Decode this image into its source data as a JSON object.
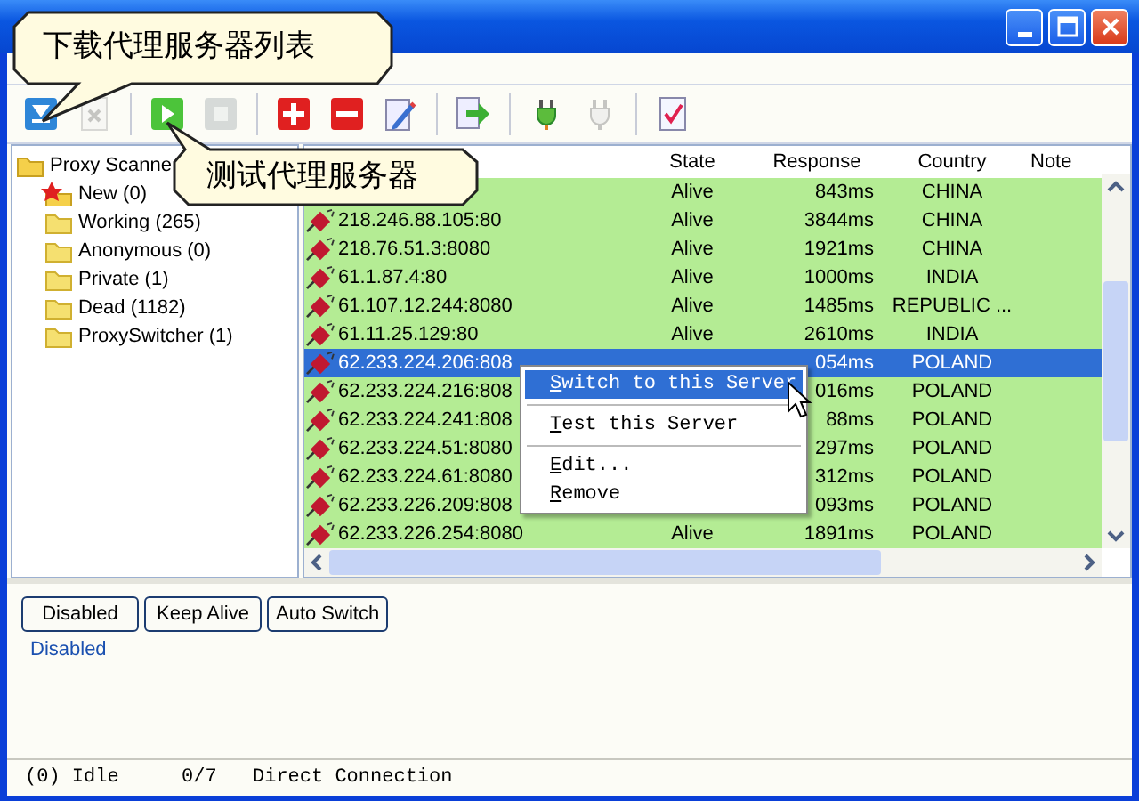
{
  "callouts": [
    {
      "text": "下载代理服务器列表",
      "kind": "down"
    },
    {
      "text": "测试代理服务器",
      "kind": "up"
    }
  ],
  "toolbar": [
    {
      "kind": "download",
      "disabled": false
    },
    {
      "kind": "delete",
      "disabled": true
    },
    {
      "kind": "play",
      "disabled": false
    },
    {
      "kind": "stop",
      "disabled": true
    },
    {
      "kind": "add",
      "disabled": false
    },
    {
      "kind": "remove",
      "disabled": false
    },
    {
      "kind": "edit",
      "disabled": false
    },
    {
      "kind": "export",
      "disabled": false
    },
    {
      "kind": "plug",
      "disabled": false
    },
    {
      "kind": "plug",
      "disabled": true
    },
    {
      "kind": "check",
      "disabled": false
    }
  ],
  "tree": {
    "label": "Proxy Scanne",
    "children": [
      {
        "label": "New (0)",
        "kind": "new"
      },
      {
        "label": "Working (265)",
        "kind": "folder"
      },
      {
        "label": "Anonymous (0)",
        "kind": "folder"
      },
      {
        "label": "Private (1)",
        "kind": "folder"
      },
      {
        "label": "Dead (1182)",
        "kind": "folder"
      },
      {
        "label": "ProxySwitcher (1)",
        "kind": "folder"
      }
    ]
  },
  "table": {
    "columns": [
      "State",
      "Response",
      "Country",
      "Note"
    ],
    "rows": [
      {
        "state": "Alive",
        "response": "843ms",
        "country": "CHINA",
        "selected": false
      },
      {
        "address": "218.246.88.105:80",
        "state": "Alive",
        "response": "3844ms",
        "country": "CHINA",
        "selected": false
      },
      {
        "address": "218.76.51.3:8080",
        "state": "Alive",
        "response": "1921ms",
        "country": "CHINA",
        "selected": false
      },
      {
        "address": "61.1.87.4:80",
        "state": "Alive",
        "response": "1000ms",
        "country": "INDIA",
        "selected": false
      },
      {
        "address": "61.107.12.244:8080",
        "state": "Alive",
        "response": "1485ms",
        "country": "REPUBLIC ...",
        "selected": false
      },
      {
        "address": "61.11.25.129:80",
        "state": "Alive",
        "response": "2610ms",
        "country": "INDIA",
        "selected": false
      },
      {
        "address": "62.233.224.206:808",
        "response": "054ms",
        "country": "POLAND",
        "selected": true
      },
      {
        "address": "62.233.224.216:808",
        "response": "016ms",
        "country": "POLAND",
        "selected": false
      },
      {
        "address": "62.233.224.241:808",
        "response": "88ms",
        "country": "POLAND",
        "selected": false
      },
      {
        "address": "62.233.224.51:8080",
        "response": "297ms",
        "country": "POLAND",
        "selected": false
      },
      {
        "address": "62.233.224.61:8080",
        "response": "312ms",
        "country": "POLAND",
        "selected": false
      },
      {
        "address": "62.233.226.209:808",
        "response": "093ms",
        "country": "POLAND",
        "selected": false
      },
      {
        "address": "62.233.226.254:8080",
        "state": "Alive",
        "response": "1891ms",
        "country": "POLAND",
        "selected": false
      }
    ]
  },
  "context_menu": [
    {
      "label": "Switch to this Server",
      "selected": true,
      "separator_after": true
    },
    {
      "label": "Test this Server",
      "selected": false,
      "separator_after": true
    },
    {
      "label": "Edit...",
      "selected": false,
      "separator_after": false
    },
    {
      "label": "Remove",
      "selected": false,
      "separator_after": false
    }
  ],
  "mode_buttons": [
    {
      "label": "Disabled"
    },
    {
      "label": "Keep Alive"
    },
    {
      "label": "Auto Switch"
    }
  ],
  "mode_text": "Disabled",
  "status_bar": [
    "(0) Idle",
    "0/7",
    "Direct Connection"
  ]
}
